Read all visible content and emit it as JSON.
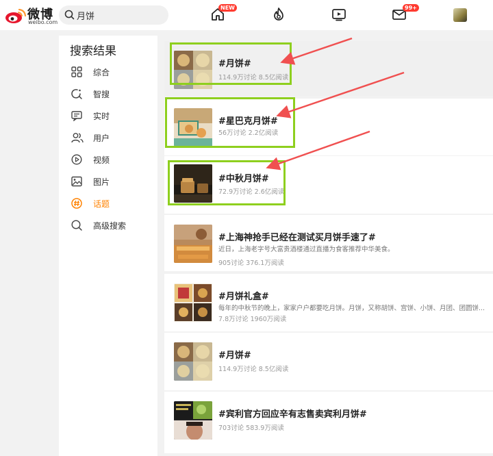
{
  "header": {
    "logo_name": "微博",
    "logo_sub": "weibo.com",
    "search_value": "月饼",
    "home_badge": "NEW",
    "message_badge": "99+"
  },
  "sidebar": {
    "title": "搜索结果",
    "items": [
      {
        "label": "综合",
        "icon": "grid-icon"
      },
      {
        "label": "智搜",
        "icon": "smart-search-icon"
      },
      {
        "label": "实时",
        "icon": "realtime-icon"
      },
      {
        "label": "用户",
        "icon": "users-icon"
      },
      {
        "label": "视频",
        "icon": "video-play-icon"
      },
      {
        "label": "图片",
        "icon": "image-icon"
      },
      {
        "label": "话题",
        "icon": "hashtag-icon",
        "active": true
      },
      {
        "label": "高级搜索",
        "icon": "search-icon"
      }
    ],
    "active_color": "#ff8200"
  },
  "results": [
    {
      "title": "#月饼#",
      "desc": "",
      "stats": "114.9万讨论 8.5亿阅读",
      "highlighted": true
    },
    {
      "title": "#星巴克月饼#",
      "desc": "",
      "stats": "56万讨论 2.2亿阅读",
      "highlighted": true
    },
    {
      "title": "#中秋月饼#",
      "desc": "",
      "stats": "72.9万讨论 2.6亿阅读",
      "highlighted": true
    },
    {
      "title": "#上海神抢手已经在测试买月饼手速了#",
      "desc": "近日，上海老字号大富贵酒楼通过直播为食客推荐中华美食。",
      "stats": "905讨论 376.1万阅读"
    },
    {
      "title": "#月饼礼盒#",
      "desc": "每年的中秋节的晚上，家家户户都要吃月饼。月饼，又称胡饼、宫饼、小饼、月团、团圆饼...",
      "stats": "7.8万讨论 1960万阅读"
    },
    {
      "title": "#月饼#",
      "desc": "",
      "stats": "114.9万讨论 8.5亿阅读"
    },
    {
      "title": "#宾利官方回应辛有志售卖宾利月饼#",
      "desc": "",
      "stats": "703讨论 583.9万阅读"
    }
  ],
  "annotation": {
    "highlight_color": "#8ecf1e",
    "arrow_color": "#f05050"
  }
}
